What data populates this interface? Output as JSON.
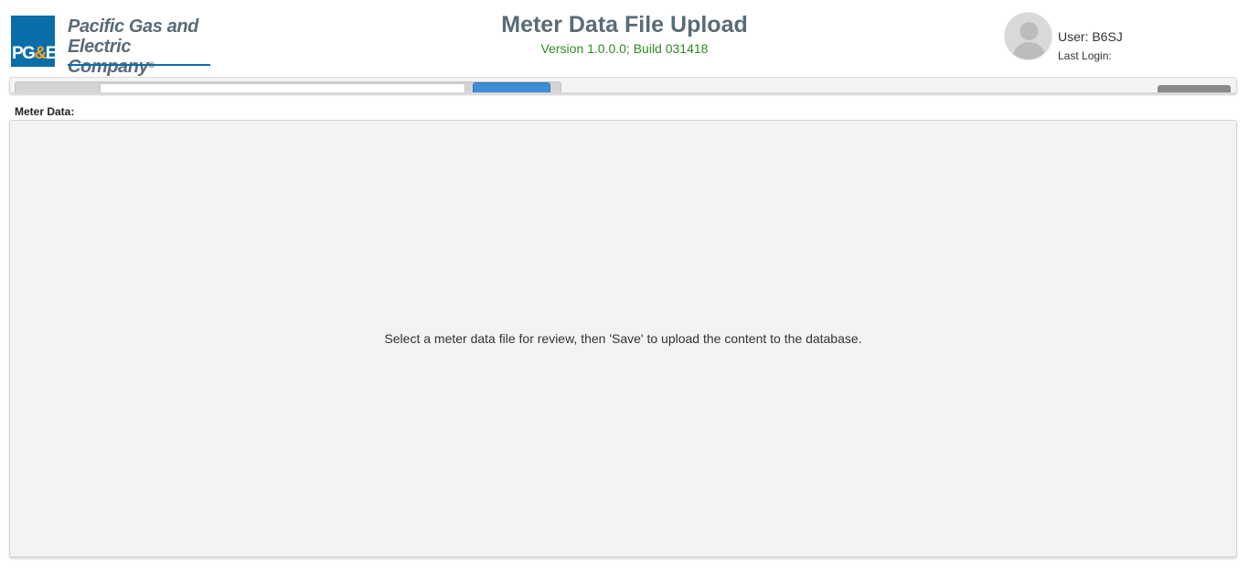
{
  "branding": {
    "company_line1": "Pacific Gas and",
    "company_line2": "Electric Company",
    "registered_mark": "®",
    "logo_letters_pg": "PG",
    "logo_letters_amp": "&",
    "logo_letters_e": "E",
    "brand_color": "#0a6ea8",
    "accent_color": "#f5a623",
    "icon": "pge-logo-icon"
  },
  "header": {
    "title": "Meter Data File Upload",
    "version": "Version 1.0.0.0; Build 031418",
    "title_color": "#5a6b78",
    "version_color": "#2e8b20"
  },
  "user": {
    "label": "User: B6SJ",
    "last_login": "Last Login:",
    "avatar_icon": "user-avatar-icon"
  },
  "toolbar": {
    "file_input_value": "",
    "browse_color": "#3d8ed4",
    "save_color": "#8a8a8a"
  },
  "main": {
    "section_label": "Meter Data:",
    "message": "Select a meter data file for review, then 'Save' to upload the content to the database."
  }
}
